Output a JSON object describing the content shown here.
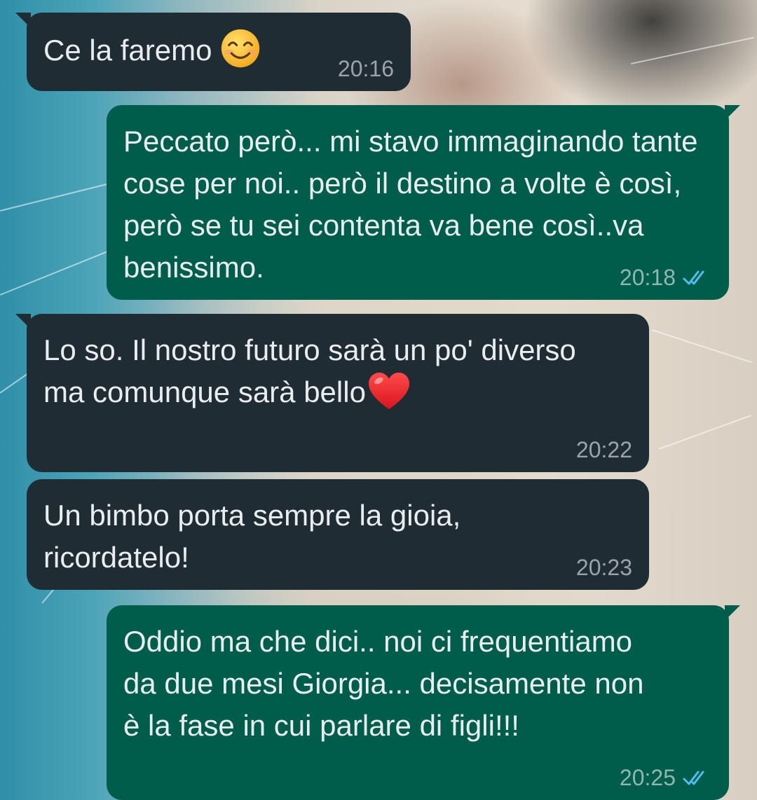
{
  "chat": {
    "messages": [
      {
        "direction": "incoming",
        "text": "Ce la faremo",
        "emoji": "smiling-face-icon",
        "time": "20:16"
      },
      {
        "direction": "outgoing",
        "text": "Peccato però... mi stavo immaginando tante cose per noi.. però il destino a volte è così, però se tu sei contenta va bene così..va benissimo.",
        "time": "20:18",
        "status": "read-ticks-icon"
      },
      {
        "direction": "incoming",
        "text": "Lo so. Il nostro futuro sarà un po' diverso ma comunque sarà bello",
        "emoji": "red-heart-icon",
        "time": "20:22"
      },
      {
        "direction": "incoming",
        "text": "Un bimbo porta sempre la gioia, ricordatelo!",
        "time": "20:23"
      },
      {
        "direction": "outgoing",
        "text": "Oddio ma che dici.. noi ci frequentiamo da due mesi Giorgia... decisamente non è la fase in cui parlare di figli!!!",
        "time": "20:25",
        "status": "read-ticks-icon"
      }
    ]
  },
  "colors": {
    "incoming_bubble": "#202c33",
    "outgoing_bubble": "#005c4b",
    "text": "#e9edef",
    "read_ticks": "#53bdeb"
  }
}
